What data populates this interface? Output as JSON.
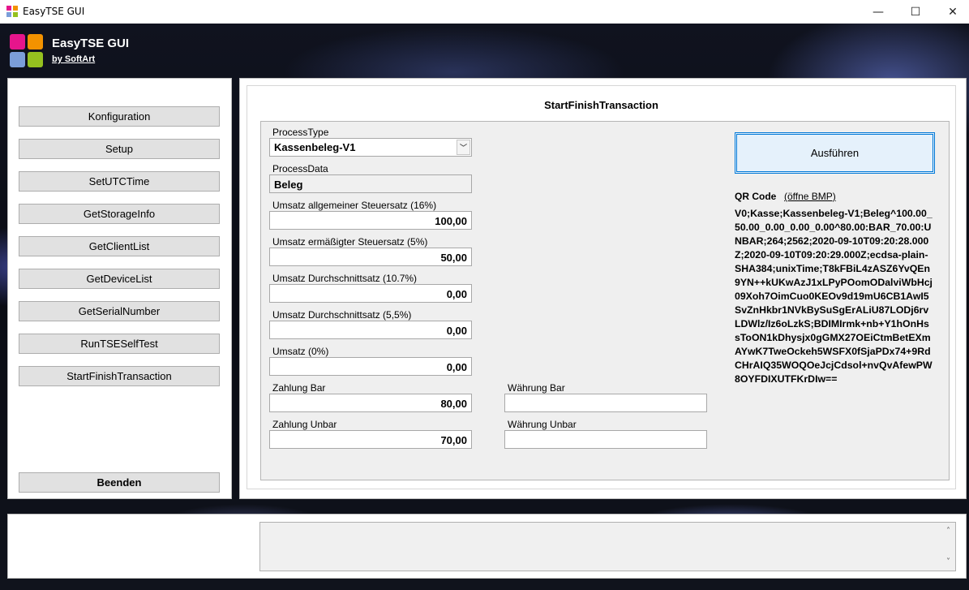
{
  "window": {
    "title": "EasyTSE GUI",
    "minimize_glyph": "—",
    "maximize_glyph": "☐",
    "close_glyph": "✕"
  },
  "brand": {
    "name": "EasyTSE GUI",
    "byline": "by SoftArt",
    "logo_colors": [
      "#e6158c",
      "#f39200",
      "#7b9ed9",
      "#95c11f"
    ]
  },
  "nav": {
    "items": [
      {
        "label": "Konfiguration"
      },
      {
        "label": "Setup"
      },
      {
        "label": "SetUTCTime"
      },
      {
        "label": "GetStorageInfo"
      },
      {
        "label": "GetClientList"
      },
      {
        "label": "GetDeviceList"
      },
      {
        "label": "GetSerialNumber"
      },
      {
        "label": "RunTSESelfTest"
      },
      {
        "label": "StartFinishTransaction"
      }
    ],
    "exit_label": "Beenden"
  },
  "main": {
    "title": "StartFinishTransaction",
    "process_type": {
      "label": "ProcessType",
      "value": "Kassenbeleg-V1",
      "arrow": "﹀"
    },
    "process_data": {
      "label": "ProcessData",
      "value": "Beleg"
    },
    "fields": [
      {
        "label": "Umsatz allgemeiner Steuersatz (16%)",
        "value": "100,00"
      },
      {
        "label": "Umsatz ermäßigter Steuersatz (5%)",
        "value": "50,00"
      },
      {
        "label": "Umsatz Durchschnittsatz (10.7%)",
        "value": "0,00"
      },
      {
        "label": "Umsatz Durchschnittsatz (5,5%)",
        "value": "0,00"
      },
      {
        "label": "Umsatz (0%)",
        "value": "0,00"
      },
      {
        "label": "Zahlung Bar",
        "value": "80,00"
      },
      {
        "label": "Zahlung Unbar",
        "value": "70,00"
      }
    ],
    "currency_bar": {
      "label": "Währung Bar",
      "value": ""
    },
    "currency_unbar": {
      "label": "Währung Unbar",
      "value": ""
    },
    "execute_label": "Ausführen",
    "qr": {
      "label": "QR Code",
      "link": "(öffne BMP)",
      "text": "V0;Kasse;Kassenbeleg-V1;Beleg^100.00_50.00_0.00_0.00_0.00^80.00:BAR_70.00:UNBAR;264;2562;2020-09-10T09:20:28.000Z;2020-09-10T09:20:29.000Z;ecdsa-plain-SHA384;unixTime;T8kFBiL4zASZ6YvQEn9YN++kUKwAzJ1xLPyPOomODalviWbHcj09Xoh7OimCuo0KEOv9d19mU6CB1AwI5SvZnHkbr1NVkBySuSgErALiU87LODj6rvLDWlz/Iz6oLzkS;BDIMIrmk+nb+Y1hOnHssToON1kDhysjx0gGMX27OEiCtmBetEXmAYwK7TweOckeh5WSFX0fSjaPDx74+9RdCHrAIQ35WOQOeJcjCdsol+nvQvAfewPW8OYFDIXUTFKrDIw=="
    }
  },
  "log": {
    "value": "",
    "scroll_up": "˄",
    "scroll_down": "˅"
  }
}
